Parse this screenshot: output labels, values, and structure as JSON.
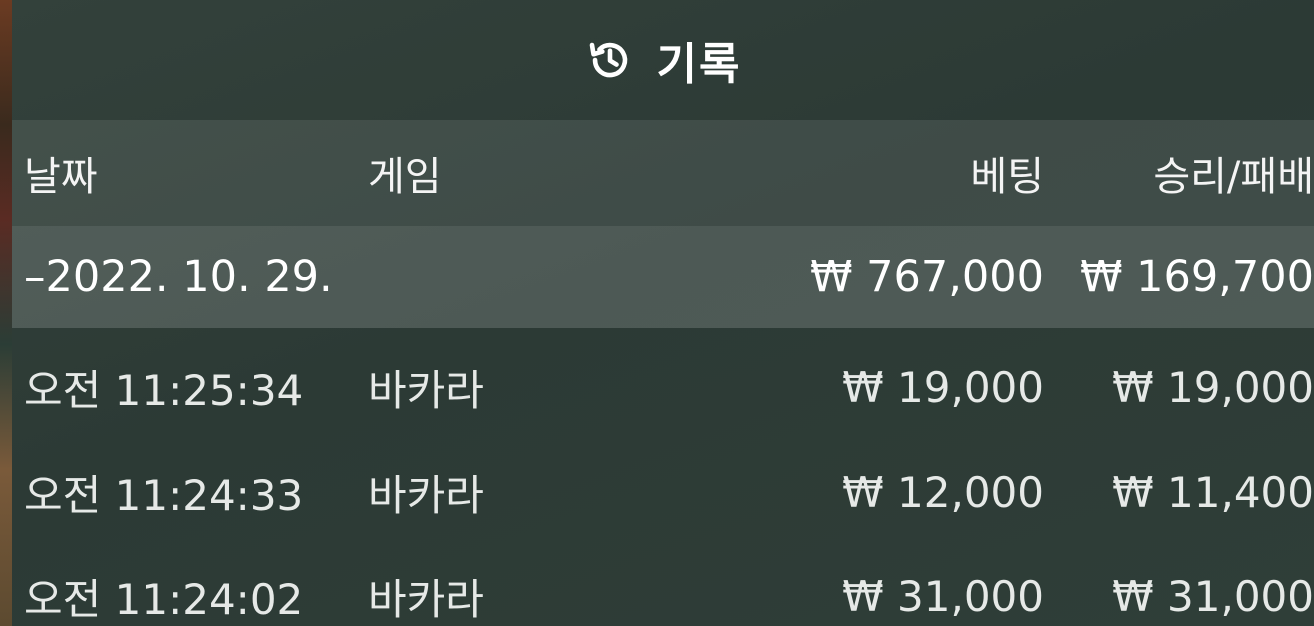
{
  "header": {
    "title": "기록",
    "icon": "history-icon"
  },
  "columns": {
    "date": "날짜",
    "game": "게임",
    "bet": "베팅",
    "win_loss": "승리/패배"
  },
  "summary": {
    "date": "–2022. 10. 29.",
    "bet": "₩ 767,000",
    "win_loss": "₩ 169,700"
  },
  "rows": [
    {
      "time": "오전 11:25:34",
      "game": "바카라",
      "bet": "₩ 19,000",
      "win_loss": "₩ 19,000"
    },
    {
      "time": "오전 11:24:33",
      "game": "바카라",
      "bet": "₩ 12,000",
      "win_loss": "₩ 11,400"
    },
    {
      "time": "오전 11:24:02",
      "game": "바카라",
      "bet": "₩ 31,000",
      "win_loss": "₩ 31,000"
    }
  ],
  "colors": {
    "panel_bg": "#2f3c37",
    "header_row_bg": "rgba(255,255,255,0.09)",
    "summary_row_bg": "rgba(255,255,255,0.16)",
    "text": "#ffffff"
  }
}
